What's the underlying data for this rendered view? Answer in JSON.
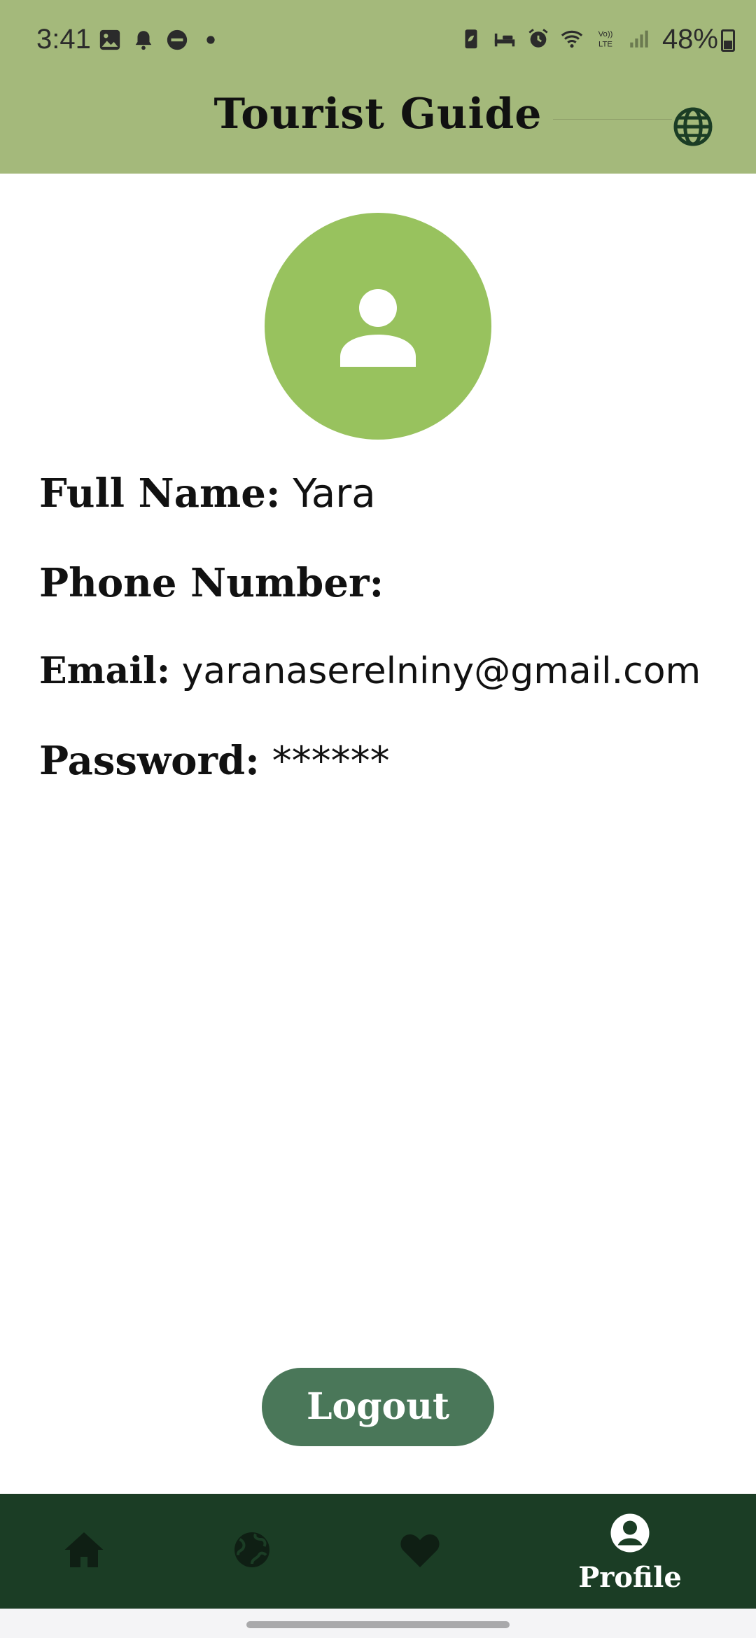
{
  "status_bar": {
    "time": "3:41",
    "battery_percent": "48%",
    "left_icons": [
      "gallery-icon",
      "bell-icon",
      "do-not-disturb-icon",
      "dot-icon"
    ],
    "right_icons": [
      "battery-saver-icon",
      "bed-icon",
      "alarm-icon",
      "wifi-icon",
      "volte-icon",
      "signal-icon"
    ],
    "volte_label": "Vo)) LTE"
  },
  "app_bar": {
    "title": "Tourist Guide",
    "language_icon": "globe-icon"
  },
  "profile": {
    "avatar_icon": "person-icon",
    "full_name_label": "Full Name:",
    "full_name_value": "Yara",
    "phone_label": "Phone Number:",
    "phone_value": "",
    "email_label": "Email:",
    "email_value": "yaranaserelniny@gmail.com",
    "password_label": "Password:",
    "password_value": "******"
  },
  "actions": {
    "logout_label": "Logout"
  },
  "bottom_nav": {
    "items": [
      {
        "icon": "home-icon",
        "label": ""
      },
      {
        "icon": "globe-icon",
        "label": ""
      },
      {
        "icon": "heart-icon",
        "label": ""
      },
      {
        "icon": "profile-icon",
        "label": "Profile",
        "selected": true
      }
    ]
  },
  "colors": {
    "header_bg": "#a4b97b",
    "avatar_bg": "#98c25e",
    "logout_bg": "#4a7759",
    "nav_bg": "#1b3d25",
    "nav_icon_inactive": "#0f1f14",
    "nav_icon_active": "#ffffff"
  }
}
